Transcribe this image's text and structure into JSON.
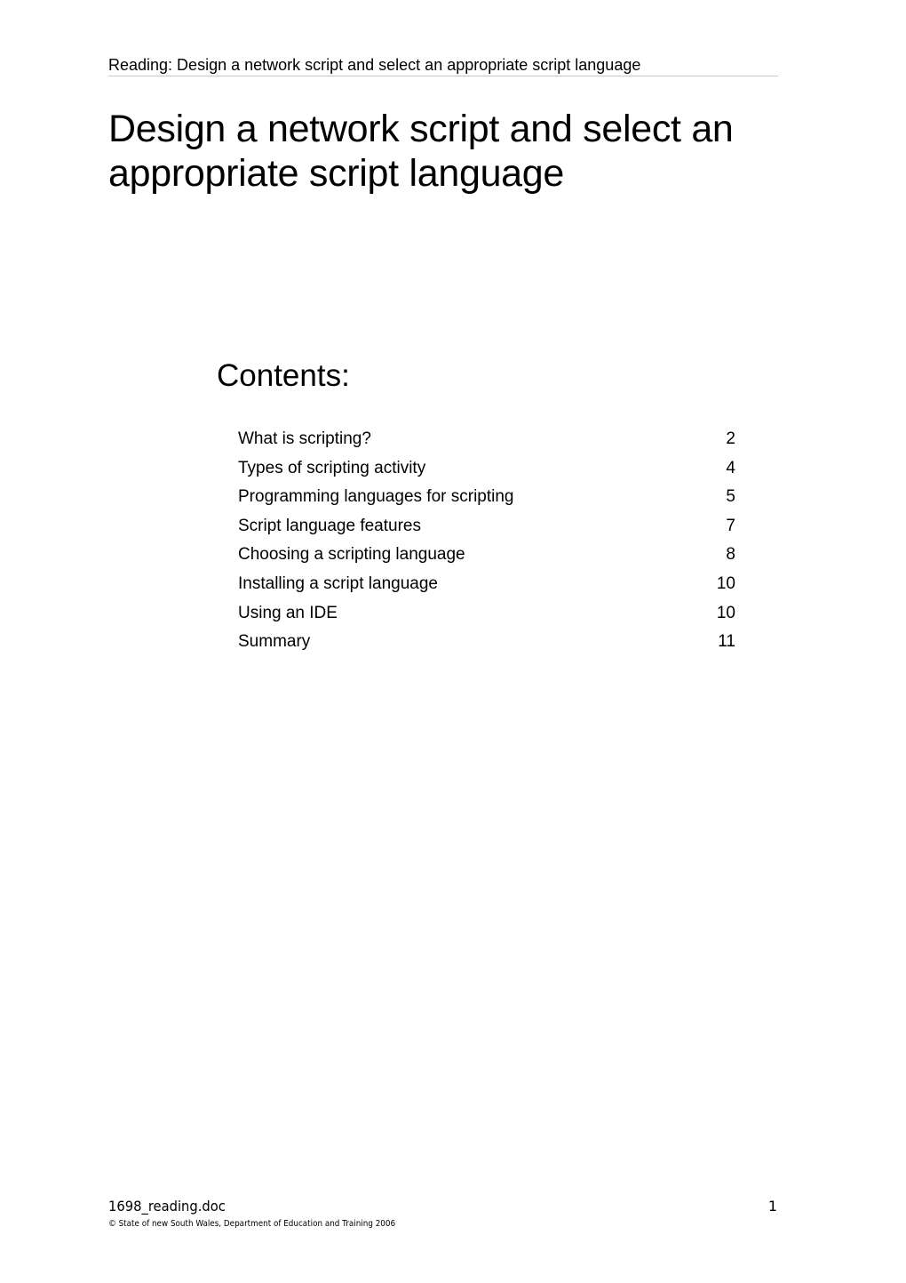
{
  "header": {
    "running_title": "Reading: Design a network script and select an appropriate script language"
  },
  "title": "Design a network script and select an appropriate script language",
  "contents": {
    "heading": "Contents:",
    "items": [
      {
        "label": "What is scripting?",
        "page": "2"
      },
      {
        "label": "Types of scripting activity",
        "page": "4"
      },
      {
        "label": "Programming languages for scripting",
        "page": "5"
      },
      {
        "label": "Script language features",
        "page": "7"
      },
      {
        "label": "Choosing a scripting language",
        "page": "8"
      },
      {
        "label": "Installing a script language",
        "page": "10"
      },
      {
        "label": "Using an IDE",
        "page": "10"
      },
      {
        "label": "Summary",
        "page": "11"
      }
    ]
  },
  "footer": {
    "filename": "1698_reading.doc",
    "page_number": "1",
    "copyright": "© State of new South Wales, Department of Education and Training 2006"
  }
}
